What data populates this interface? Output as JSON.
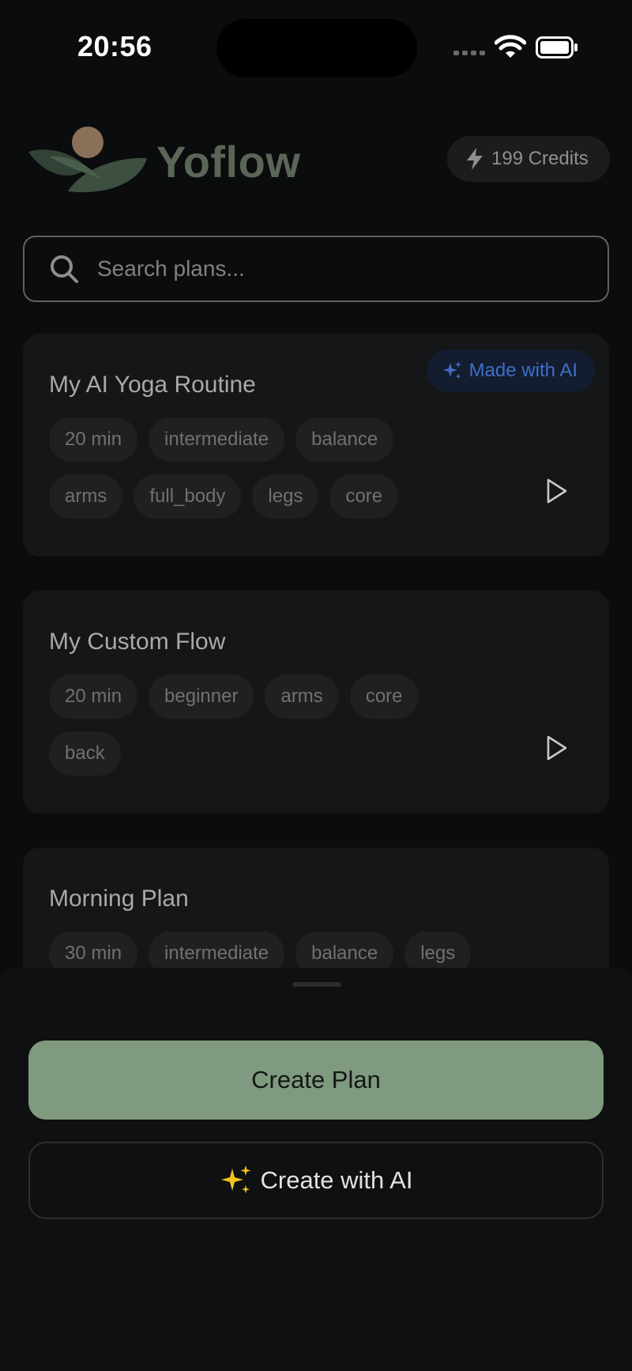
{
  "status_bar": {
    "time": "20:56"
  },
  "header": {
    "brand": "Yoflow",
    "credits": "199 Credits"
  },
  "search": {
    "placeholder": "Search plans..."
  },
  "plans": [
    {
      "title": "My AI Yoga Routine",
      "badge": "Made with AI",
      "tags": [
        "20 min",
        "intermediate",
        "balance",
        "arms",
        "full_body",
        "legs",
        "core"
      ]
    },
    {
      "title": "My Custom Flow",
      "tags": [
        "20 min",
        "beginner",
        "arms",
        "core",
        "back"
      ]
    },
    {
      "title": "Morning Plan",
      "tags": [
        "30 min",
        "intermediate",
        "balance",
        "legs"
      ]
    }
  ],
  "actions": {
    "create_plan": "Create Plan",
    "create_with_ai": "Create with AI"
  },
  "colors": {
    "background": "#0b0c0d",
    "card": "#141617",
    "accent_green": "#7f9a7e",
    "ai_blue": "#3f6ec9",
    "logo_sun": "#8a7058"
  },
  "icons": {
    "credits": "lightning-icon",
    "search": "search-icon",
    "ai_badge": "sparkles-icon",
    "play": "play-icon",
    "create_ai": "sparkles-icon"
  }
}
